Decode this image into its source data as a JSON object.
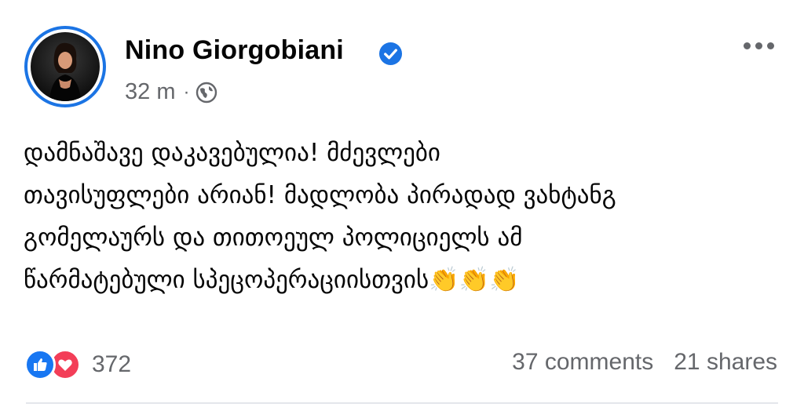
{
  "post": {
    "author": "Nino Giorgobiani",
    "time": "32 m",
    "separator": "·",
    "audience_icon": "globe-icon",
    "verified_icon": "verified-badge-icon",
    "text_lines": [
      "დამნაშავე დაკავებულია! მძევლები",
      "თავისუფლები არიან! მადლობა პირადად ვახტანგ",
      "გომელაურს და  თითოეულ პოლიციელს ამ",
      "წარმატებული სპეცოპერაციისთვის👏👏👏"
    ]
  },
  "engagement": {
    "reaction_icons": [
      "like-icon",
      "love-icon"
    ],
    "reaction_count": "372",
    "comments": "37 comments",
    "shares": "21 shares"
  },
  "colors": {
    "accent": "#1b74e4",
    "like": "#1877f2",
    "love": "#f33e58",
    "secondary_text": "#65676b"
  }
}
